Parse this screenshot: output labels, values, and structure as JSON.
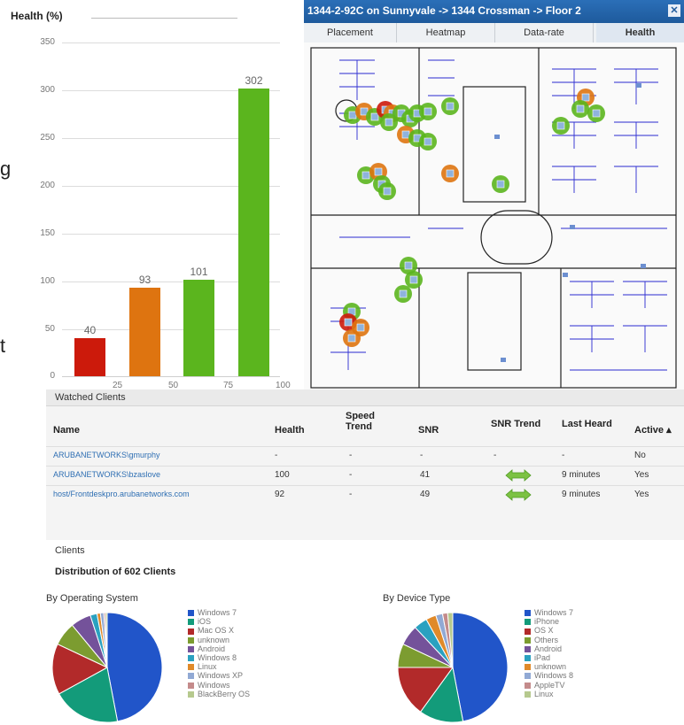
{
  "chart": {
    "title": "Health (%)",
    "y_ticks": [
      "350",
      "300",
      "250",
      "200",
      "150",
      "100",
      "50",
      "0"
    ],
    "x_ticks": [
      "25",
      "50",
      "75",
      "100"
    ]
  },
  "chart_data": {
    "type": "bar",
    "title": "Health (%)",
    "xlabel": "",
    "ylabel": "",
    "ylim": [
      0,
      350
    ],
    "xlim": [
      0,
      100
    ],
    "categories": [
      "0-25",
      "25-50",
      "50-75",
      "75-100"
    ],
    "values": [
      40,
      93,
      101,
      302
    ],
    "colors": [
      "#cc1a0b",
      "#de7410",
      "#5bb51e",
      "#5bb51e"
    ]
  },
  "fragments": {
    "g": "g",
    "t": "t"
  },
  "map": {
    "title": "1344-2-92C on Sunnyvale -> 1344 Crossman -> Floor 2",
    "close": "✕",
    "tabs": [
      "Placement",
      "Heatmap",
      "Data-rate",
      "Health"
    ],
    "active_tab": 3
  },
  "watched": {
    "title": "Watched Clients",
    "columns": {
      "name": "Name",
      "health": "Health",
      "speed_trend": "Speed\nTrend",
      "snr": "SNR",
      "snr_trend": "SNR Trend",
      "last_heard": "Last Heard",
      "active": "Active ▴"
    },
    "rows": [
      {
        "name": "ARUBANETWORKS\\gmurphy",
        "health": "-",
        "speed_trend": "-",
        "snr": "-",
        "snr_trend": "-",
        "last_heard": "-",
        "active": "No",
        "trend_icon": false
      },
      {
        "name": "ARUBANETWORKS\\bzaslove",
        "health": "100",
        "speed_trend": "-",
        "snr": "41",
        "snr_trend": "",
        "last_heard": "9 minutes",
        "active": "Yes",
        "trend_icon": true
      },
      {
        "name": "host/Frontdeskpro.arubanetworks.com",
        "health": "92",
        "speed_trend": "-",
        "snr": "49",
        "snr_trend": "",
        "last_heard": "9 minutes",
        "active": "Yes",
        "trend_icon": true
      }
    ]
  },
  "clients": {
    "title": "Clients",
    "distribution_title": "Distribution of 602 Clients",
    "os": {
      "title": "By Operating System",
      "legend": [
        {
          "label": "Windows 7",
          "color": "#2155c9"
        },
        {
          "label": "iOS",
          "color": "#139b7a"
        },
        {
          "label": "Mac OS X",
          "color": "#b22a2a"
        },
        {
          "label": "unknown",
          "color": "#7c9c30"
        },
        {
          "label": "Android",
          "color": "#74529a"
        },
        {
          "label": "Windows 8",
          "color": "#2aa1c0"
        },
        {
          "label": "Linux",
          "color": "#e08a2a"
        },
        {
          "label": "Windows XP",
          "color": "#91a9d4"
        },
        {
          "label": "Windows",
          "color": "#c48b8b"
        },
        {
          "label": "BlackBerry OS",
          "color": "#b6c98e"
        }
      ],
      "slices": [
        0.47,
        0.2,
        0.15,
        0.07,
        0.06,
        0.02,
        0.01,
        0.01,
        0.005,
        0.005
      ]
    },
    "device": {
      "title": "By Device Type",
      "legend": [
        {
          "label": "Windows 7",
          "color": "#2155c9"
        },
        {
          "label": "iPhone",
          "color": "#139b7a"
        },
        {
          "label": "OS X",
          "color": "#b22a2a"
        },
        {
          "label": "Others",
          "color": "#7c9c30"
        },
        {
          "label": "Android",
          "color": "#74529a"
        },
        {
          "label": "iPad",
          "color": "#2aa1c0"
        },
        {
          "label": "unknown",
          "color": "#e08a2a"
        },
        {
          "label": "Windows 8",
          "color": "#91a9d4"
        },
        {
          "label": "AppleTV",
          "color": "#c48b8b"
        },
        {
          "label": "Linux",
          "color": "#b6c98e"
        }
      ],
      "slices": [
        0.47,
        0.13,
        0.15,
        0.07,
        0.06,
        0.04,
        0.03,
        0.02,
        0.015,
        0.015
      ]
    }
  }
}
